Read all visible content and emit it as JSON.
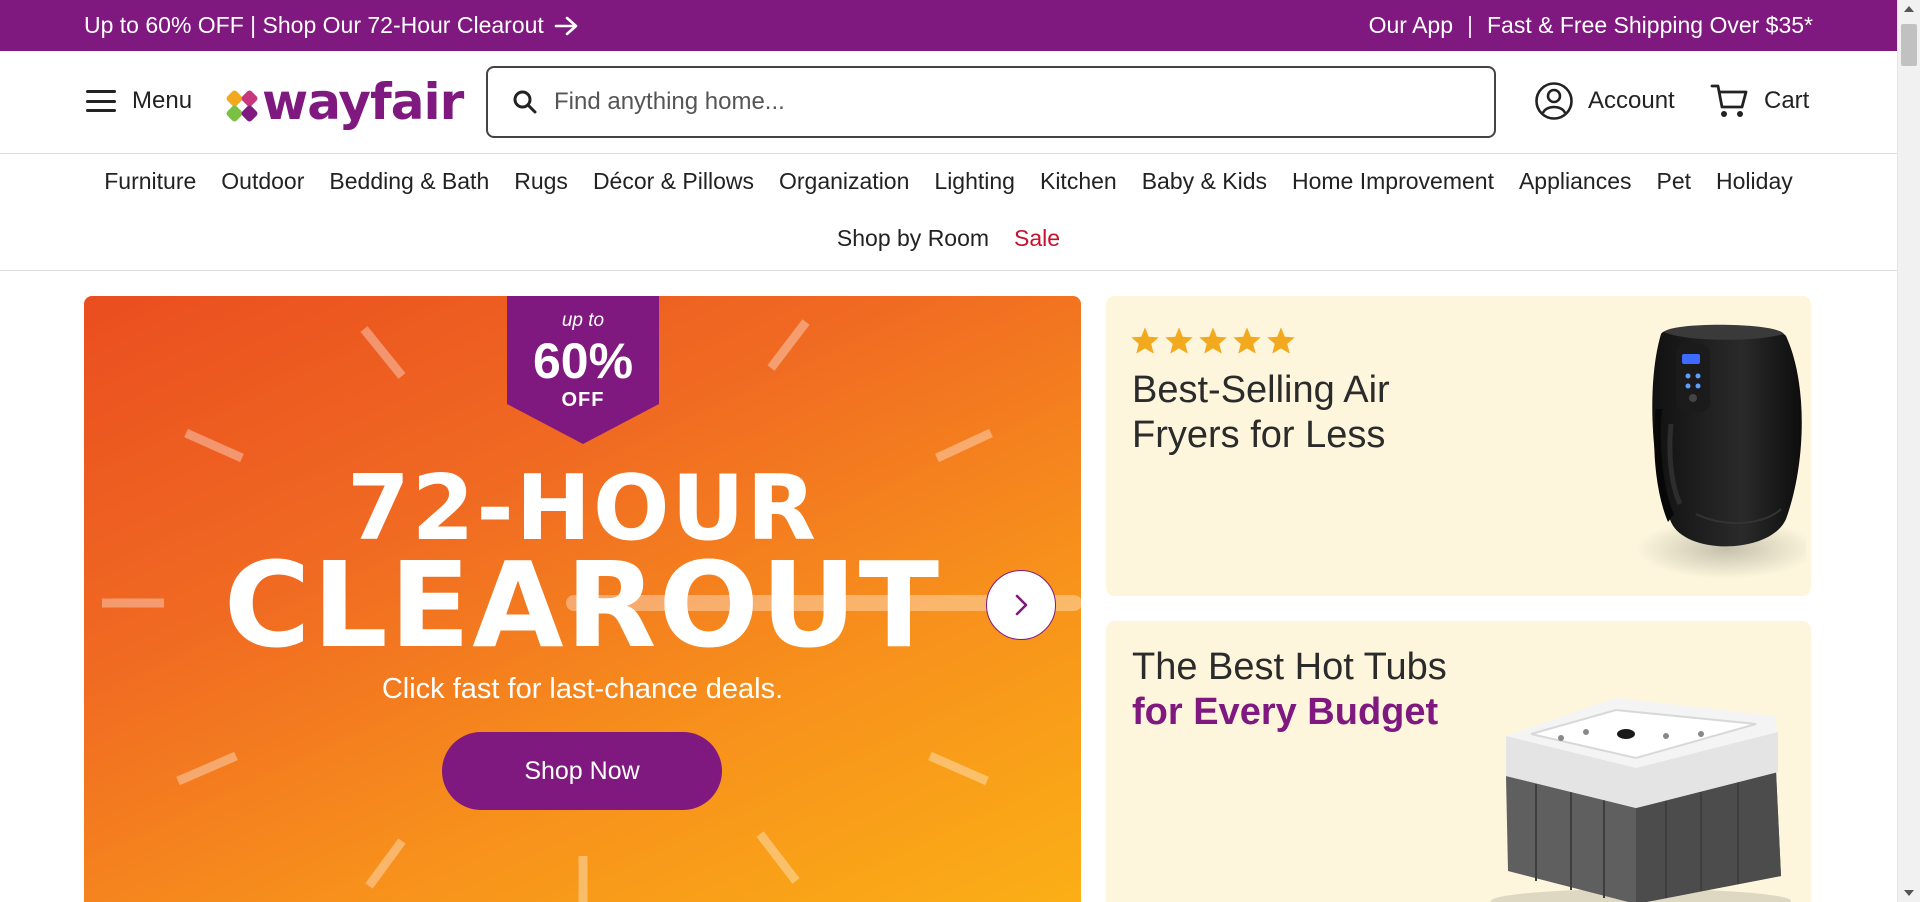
{
  "promo_bar": {
    "left_text": "Up to 60% OFF | Shop Our 72-Hour Clearout",
    "right_app": "Our App",
    "right_separator": "|",
    "right_shipping": "Fast & Free Shipping Over $35*"
  },
  "header": {
    "menu_label": "Menu",
    "logo_text": "wayfair",
    "search_placeholder": "Find anything home...",
    "account_label": "Account",
    "cart_label": "Cart"
  },
  "categories": {
    "row1": [
      "Furniture",
      "Outdoor",
      "Bedding & Bath",
      "Rugs",
      "Décor & Pillows",
      "Organization",
      "Lighting",
      "Kitchen",
      "Baby & Kids",
      "Home Improvement",
      "Appliances",
      "Pet",
      "Holiday"
    ],
    "shop_by_room": "Shop by Room",
    "sale": "Sale"
  },
  "hero": {
    "badge_up_to": "up to",
    "badge_percent": "60%",
    "badge_off": "OFF",
    "title_line1": "72-HOUR",
    "title_line2": "CLEAROUT",
    "subtitle": "Click fast for last-chance deals.",
    "cta_label": "Shop Now"
  },
  "cards": {
    "air_fryers": {
      "rating_stars": 5,
      "title": "Best-Selling Air Fryers for Less"
    },
    "hot_tubs": {
      "title_line1": "The Best Hot Tubs",
      "title_line2": "for Every Budget"
    }
  },
  "colors": {
    "brand_purple": "#7f187f",
    "sale_red": "#c8102e",
    "hero_orange_start": "#ea4e1f",
    "hero_orange_end": "#fbb016",
    "card_cream": "#fdf6dd",
    "star_gold": "#f2a91d"
  },
  "icons": [
    "hamburger-icon",
    "wayfair-logo-mark",
    "search-icon",
    "account-icon",
    "cart-icon",
    "arrow-right-icon",
    "chevron-right-icon",
    "star-icon"
  ]
}
